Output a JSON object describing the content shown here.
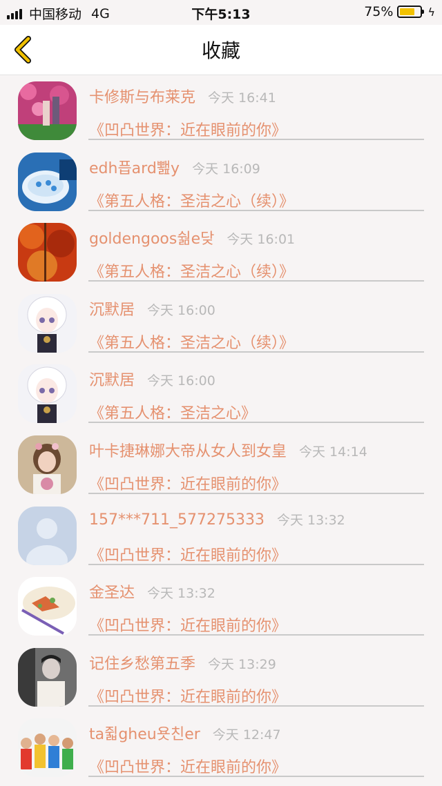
{
  "status_bar": {
    "carrier": "中国移动",
    "network": "4G",
    "time": "下午5:13",
    "battery_pct": "75%",
    "battery_level": 0.75,
    "battery_color": "#f2c200"
  },
  "nav": {
    "back_icon": "chevron-left-icon",
    "title": "收藏",
    "accent": "#f0c000"
  },
  "colors": {
    "name_text": "#e5916f",
    "time_text": "#b8b8b8"
  },
  "favorites": [
    {
      "name": "卡修斯与布莱克",
      "time": "今天 16:41",
      "subject": "《凹凸世界：近在眼前的你》",
      "avatar": "flower-photo"
    },
    {
      "name": "edh픕ard뾆y",
      "time": "今天 16:09",
      "subject": "《第五人格：圣洁之心（续）》",
      "avatar": "blue-cup-photo"
    },
    {
      "name": "goldengoos숾e닺",
      "time": "今天 16:01",
      "subject": "《第五人格：圣洁之心（续）》",
      "avatar": "autumn-leaves-photo"
    },
    {
      "name": "沉默居",
      "time": "今天 16:00",
      "subject": "《第五人格：圣洁之心（续）》",
      "avatar": "anime-white-hair"
    },
    {
      "name": "沉默居",
      "time": "今天 16:00",
      "subject": "《第五人格：圣洁之心》",
      "avatar": "anime-white-hair"
    },
    {
      "name": "叶卡捷琳娜大帝从女人到女皇",
      "time": "今天 14:14",
      "subject": "《凹凸世界：近在眼前的你》",
      "avatar": "girl-flowers-photo"
    },
    {
      "name": "157***711_577275333",
      "time": "今天 13:32",
      "subject": "《凹凸世界：近在眼前的你》",
      "avatar": "default-user"
    },
    {
      "name": "金圣达",
      "time": "今天 13:32",
      "subject": "《凹凸世界：近在眼前的你》",
      "avatar": "food-plate-photo"
    },
    {
      "name": "记住乡愁第五季",
      "time": "今天 13:29",
      "subject": "《凹凸世界：近在眼前的你》",
      "avatar": "man-bw-photo"
    },
    {
      "name": "ta쥛gheu욧친er",
      "time": "今天 12:47",
      "subject": "《凹凸世界：近在眼前的你》",
      "avatar": "group-photo"
    }
  ]
}
